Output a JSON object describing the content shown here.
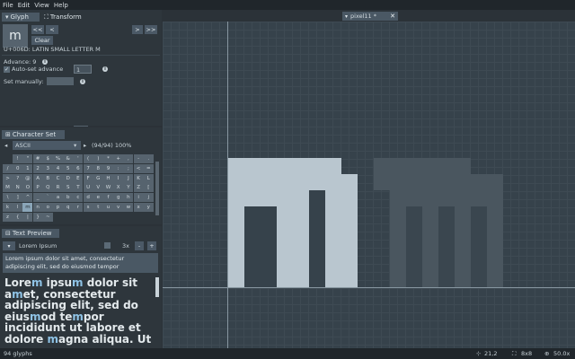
{
  "menu": [
    "File",
    "Edit",
    "View",
    "Help"
  ],
  "glyph_panel": {
    "tabs": [
      "Glyph",
      "Transform"
    ],
    "current_char": "m",
    "nav_buttons": [
      "<<",
      "<"
    ],
    "nav_buttons_right": [
      ">",
      ">>"
    ],
    "clear_label": "Clear",
    "unicode_name": "U+006D: LATIN SMALL LETTER M",
    "advance_label": "Advance: 9",
    "auto_advance_label": "Auto-set advance",
    "auto_advance_value": "1",
    "set_manually_label": "Set manually:"
  },
  "charset_panel": {
    "tab": "Character Set",
    "charset": "ASCII",
    "count": "(94/94) 100%",
    "chars": [
      "!",
      "\"",
      "#",
      "$",
      "%",
      "&",
      "'",
      "(",
      ")",
      "*",
      "+",
      ",",
      "-",
      ".",
      "/",
      "0",
      "1",
      "2",
      "3",
      "4",
      "5",
      "6",
      "7",
      "8",
      "9",
      ":",
      ";",
      "<",
      "=",
      ">",
      "?",
      "@",
      "A",
      "B",
      "C",
      "D",
      "E",
      "F",
      "G",
      "H",
      "I",
      "J",
      "K",
      "L",
      "M",
      "N",
      "O",
      "P",
      "Q",
      "R",
      "S",
      "T",
      "U",
      "V",
      "W",
      "X",
      "Y",
      "Z",
      "[",
      "\\",
      "]",
      "^",
      "_",
      "`",
      "a",
      "b",
      "c",
      "d",
      "e",
      "f",
      "g",
      "h",
      "i",
      "j",
      "k",
      "l",
      "m",
      "n",
      "o",
      "p",
      "q",
      "r",
      "s",
      "t",
      "u",
      "v",
      "w",
      "x",
      "y",
      "z",
      "{",
      "|",
      "}",
      "~"
    ]
  },
  "preview_panel": {
    "tab": "Text Preview",
    "preset": "Lorem Ipsum",
    "scale": "3x",
    "input_text": "Lorem ipsum dolor sit amet, consectetur adipiscing elit, sed do eiusmod tempor",
    "preview_lines": [
      [
        "Lore",
        "m",
        " ipsu",
        "m",
        " dolor sit"
      ],
      [
        "a",
        "m",
        "et, consectetur",
        "",
        ""
      ],
      [
        "adipiscing elit, sed do",
        "",
        "",
        "",
        ""
      ],
      [
        "eius",
        "m",
        "od te",
        "m",
        "por"
      ],
      [
        "incididunt ut labore et",
        "",
        "",
        "",
        ""
      ],
      [
        "dolore ",
        "m",
        "agna aliqua. Ut",
        "",
        ""
      ]
    ]
  },
  "document_tab": {
    "label": "pixel11 *"
  },
  "status": {
    "glyph_count": "94 glyphs",
    "cursor": "21,2",
    "size": "8x8",
    "zoom": "50.0x"
  },
  "colors": {
    "glyph_fill": "#b9c6cf",
    "ghost_fill": "#4a565f",
    "grid_bg": "#36424b",
    "accent": "#4a5864"
  }
}
